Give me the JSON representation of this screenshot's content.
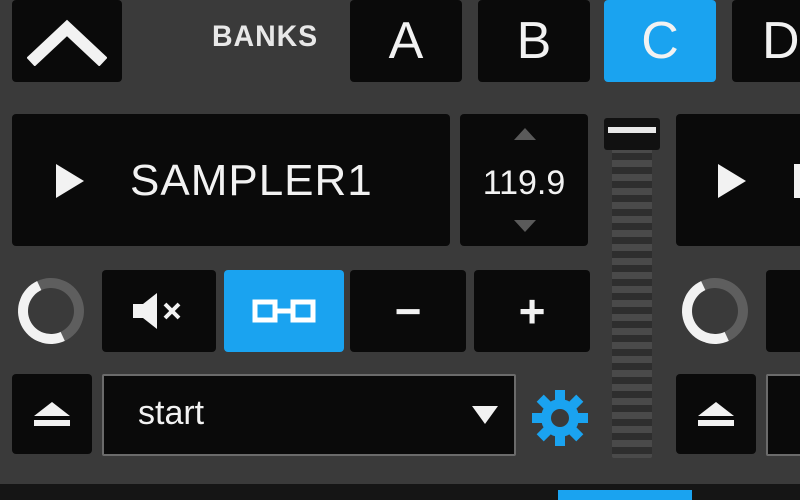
{
  "header": {
    "banks_label": "BANKS",
    "banks": [
      {
        "label": "A",
        "active": false
      },
      {
        "label": "B",
        "active": false
      },
      {
        "label": "C",
        "active": true
      },
      {
        "label": "D",
        "active": false
      }
    ]
  },
  "sampler": {
    "name": "SAMPLER1",
    "bpm": "119.9"
  },
  "controls": {
    "minus_label": "−",
    "plus_label": "+"
  },
  "select": {
    "value": "start"
  },
  "icons": {
    "up": "chevron-up-icon",
    "play": "play-icon",
    "mute": "speaker-muted-icon",
    "link": "link-icon",
    "eject": "eject-icon",
    "gear": "gear-icon",
    "dropdown": "chevron-down-icon"
  },
  "colors": {
    "background": "#3a3a3a",
    "panel": "#0a0a0a",
    "accent": "#1aa3f0",
    "text": "#f2f2f2"
  }
}
